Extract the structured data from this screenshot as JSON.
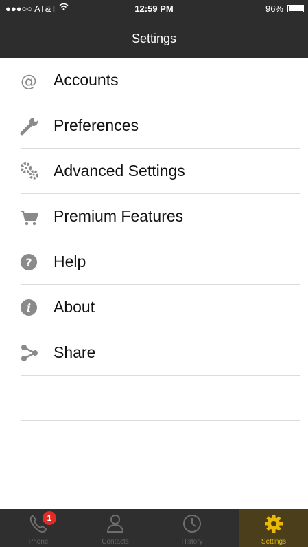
{
  "status": {
    "carrier": "●●●○○ AT&T",
    "time": "12:59 PM",
    "battery": "96%",
    "battery_level": 0.96
  },
  "nav": {
    "title": "Settings"
  },
  "menu": [
    {
      "label": "Accounts",
      "icon": "at-icon"
    },
    {
      "label": "Preferences",
      "icon": "wrench-icon"
    },
    {
      "label": "Advanced Settings",
      "icon": "gears-icon"
    },
    {
      "label": "Premium Features",
      "icon": "cart-icon"
    },
    {
      "label": "Help",
      "icon": "help-icon"
    },
    {
      "label": "About",
      "icon": "info-icon"
    },
    {
      "label": "Share",
      "icon": "share-icon"
    }
  ],
  "tabs": [
    {
      "label": "Phone",
      "badge": "1",
      "icon": "phone-icon"
    },
    {
      "label": "Contacts",
      "icon": "person-icon"
    },
    {
      "label": "History",
      "icon": "clock-icon"
    },
    {
      "label": "Settings",
      "icon": "gear-icon",
      "active": true
    }
  ],
  "colors": {
    "bar": "#2d2d2d",
    "accent": "#e8b80a",
    "badge": "#e02b26"
  }
}
